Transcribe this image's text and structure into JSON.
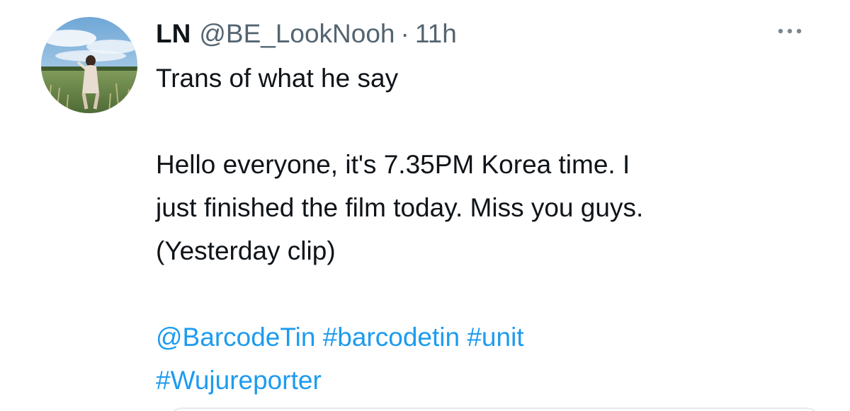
{
  "tweet": {
    "author_name": "LN",
    "author_handle": "@BE_LookNooh",
    "separator": "·",
    "time_ago": "11h",
    "more_icon": "ellipsis-icon",
    "avatar_icon": "profile-photo",
    "text_lines": [
      "Trans of what he say",
      "Hello everyone, it's 7.35PM Korea time. I",
      "just finished the film today. Miss you guys.",
      "(Yesterday clip)"
    ],
    "mention": "@BarcodeTin",
    "hashtags": [
      "#barcodetin",
      "#unit",
      "#Wujureporter"
    ],
    "colors": {
      "link": "#1d9bf0",
      "secondary_text": "#536471",
      "primary_text": "#0f1419"
    }
  }
}
